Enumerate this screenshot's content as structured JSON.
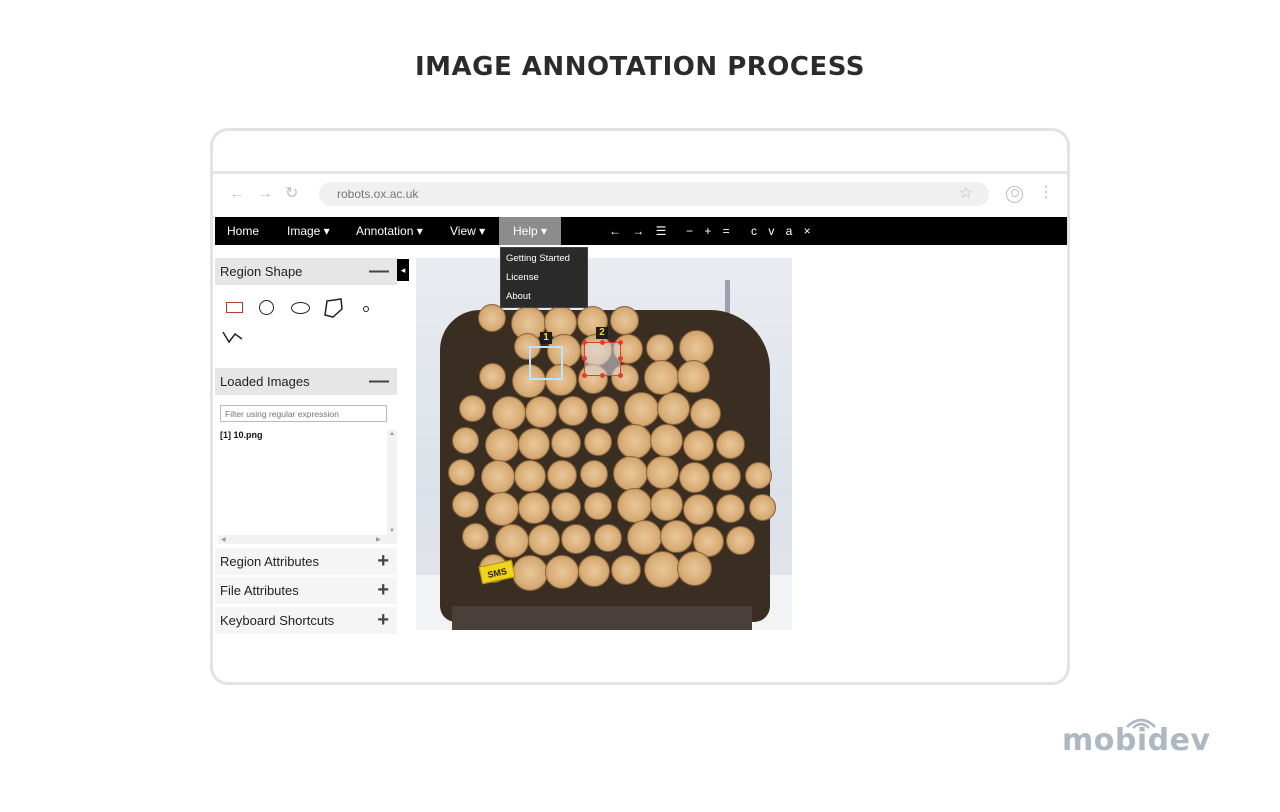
{
  "page": {
    "title": "IMAGE ANNOTATION PROCESS"
  },
  "browser": {
    "url": "robots.ox.ac.uk",
    "icons": [
      "back-arrow-icon",
      "forward-arrow-icon",
      "reload-icon",
      "star-icon",
      "profile-icon",
      "kebab-menu-icon"
    ]
  },
  "menubar": {
    "items": [
      {
        "label": "Home"
      },
      {
        "label": "Image ▾"
      },
      {
        "label": "Annotation ▾"
      },
      {
        "label": "View ▾"
      },
      {
        "label": "Help ▾"
      }
    ],
    "tools": {
      "navigate": "← → ☰",
      "zoom": "− + =",
      "edit": "c v a ×"
    },
    "accent_active": "#8c8c8c"
  },
  "help_menu": {
    "items": [
      "Getting Started",
      "License",
      "About"
    ]
  },
  "sidebar": {
    "toggle_glyph": "◂",
    "region_shape": {
      "title": "Region Shape",
      "toggle": "—",
      "shapes": [
        "rectangle",
        "circle",
        "ellipse",
        "polygon",
        "point",
        "polyline"
      ]
    },
    "loaded_images": {
      "title": "Loaded Images",
      "toggle": "—",
      "filter_placeholder": "Filter using regular expression",
      "items": [
        "[1] 10.png"
      ]
    },
    "region_attributes": {
      "title": "Region Attributes",
      "toggle": "+"
    },
    "file_attributes": {
      "title": "File Attributes",
      "toggle": "+"
    },
    "keyboard_shortcuts": {
      "title": "Keyboard Shortcuts",
      "toggle": "+"
    }
  },
  "canvas": {
    "regions": [
      {
        "label": "1",
        "color": "#bde3ff"
      },
      {
        "label": "2",
        "color": "#e43d2f"
      }
    ],
    "tag_text": "SMS"
  },
  "brand": {
    "name": "mobidev",
    "color": "#aeb8c2"
  }
}
